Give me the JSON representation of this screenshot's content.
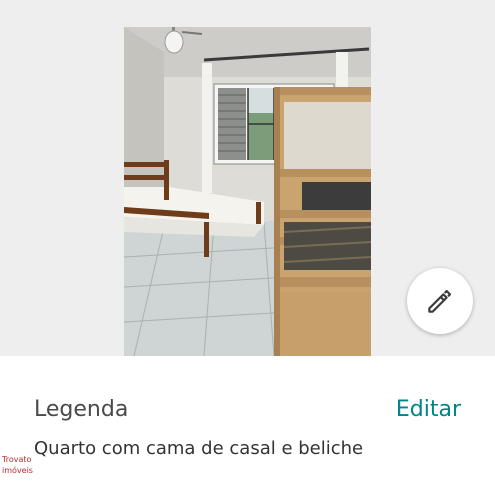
{
  "photo": {
    "edit_icon": "pencil-icon"
  },
  "caption": {
    "title": "Legenda",
    "edit_label": "Editar",
    "text": "Quarto com cama de casal e beliche"
  },
  "watermark": {
    "line1": "Trovato",
    "line2": "imóveis"
  },
  "colors": {
    "accent": "#008489",
    "watermark": "#c0282d"
  }
}
